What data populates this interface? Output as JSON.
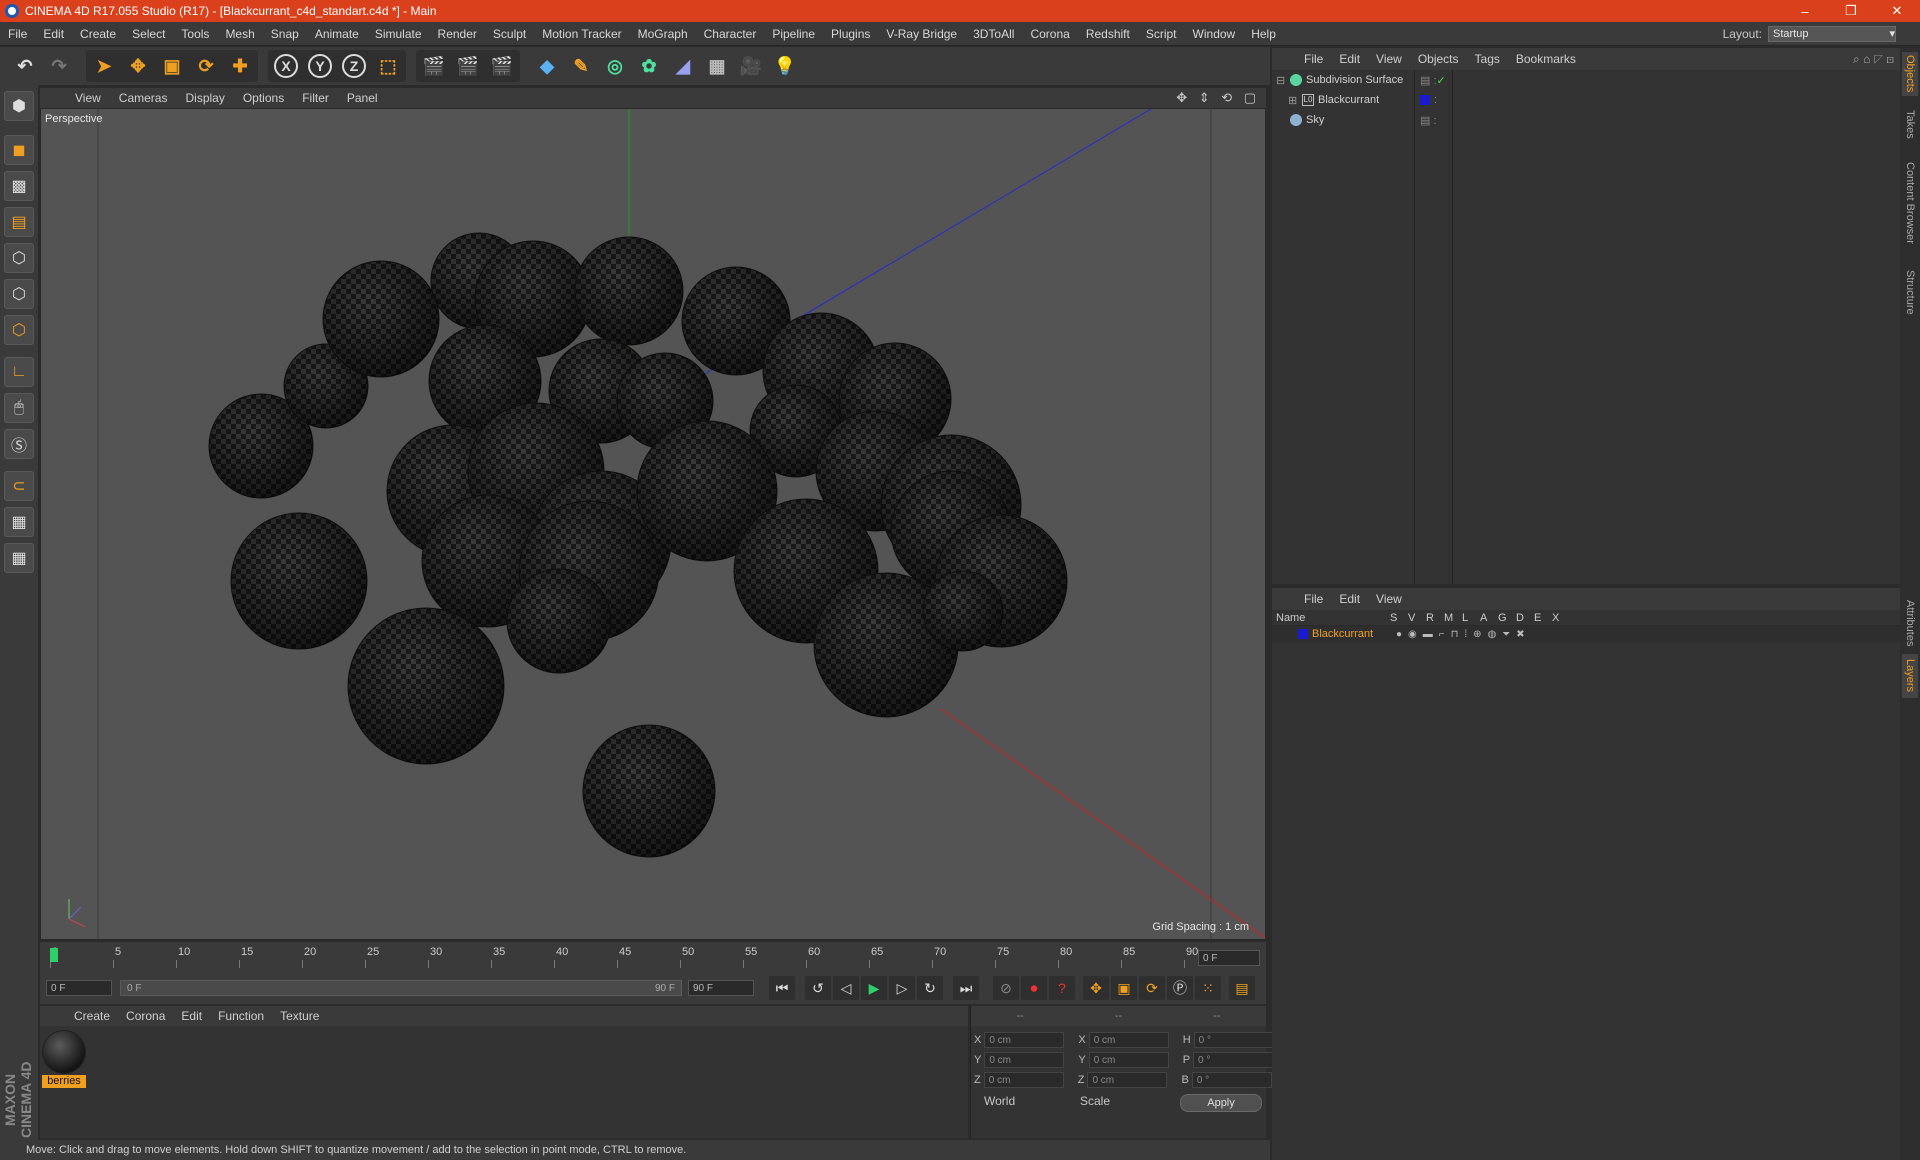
{
  "window": {
    "title": "CINEMA 4D R17.055 Studio (R17) - [Blackcurrant_c4d_standart.c4d *] - Main",
    "controls": [
      "–",
      "❐",
      "✕"
    ]
  },
  "menubar": {
    "items": [
      "File",
      "Edit",
      "Create",
      "Select",
      "Tools",
      "Mesh",
      "Snap",
      "Animate",
      "Simulate",
      "Render",
      "Sculpt",
      "Motion Tracker",
      "MoGraph",
      "Character",
      "Pipeline",
      "Plugins",
      "V-Ray Bridge",
      "3DToAll",
      "Corona",
      "Redshift",
      "Script",
      "Window",
      "Help"
    ],
    "layout_label": "Layout:",
    "layout_value": "Startup"
  },
  "toolbar": {
    "axis_x": "X",
    "axis_y": "Y",
    "axis_z": "Z"
  },
  "viewport": {
    "menu": [
      "View",
      "Cameras",
      "Display",
      "Options",
      "Filter",
      "Panel"
    ],
    "label": "Perspective",
    "grid_spacing": "Grid Spacing : 1 cm",
    "nav_icons": "✥ ⇕ ⟲ ▢"
  },
  "timeline": {
    "ticks": [
      "0",
      "5",
      "10",
      "15",
      "20",
      "25",
      "30",
      "35",
      "40",
      "45",
      "50",
      "55",
      "60",
      "65",
      "70",
      "75",
      "80",
      "85",
      "90"
    ],
    "current_frame": "0 F"
  },
  "transport": {
    "start_field": "0 F",
    "range_start": "0 F",
    "range_end": "90 F",
    "end_field": "90 F"
  },
  "material_panel": {
    "menu": [
      "Create",
      "Corona",
      "Edit",
      "Function",
      "Texture"
    ],
    "material_name": "berries"
  },
  "coords": {
    "header": [
      "--",
      "--",
      "--"
    ],
    "rows": [
      {
        "a_label": "X",
        "a_val": "0 cm",
        "b_label": "X",
        "b_val": "0 cm",
        "c_label": "H",
        "c_val": "0 °"
      },
      {
        "a_label": "Y",
        "a_val": "0 cm",
        "b_label": "Y",
        "b_val": "0 cm",
        "c_label": "P",
        "c_val": "0 °"
      },
      {
        "a_label": "Z",
        "a_val": "0 cm",
        "b_label": "Z",
        "b_val": "0 cm",
        "c_label": "B",
        "c_val": "0 °"
      }
    ],
    "space_dropdown": "World",
    "mode_dropdown": "Scale",
    "apply_label": "Apply"
  },
  "status": {
    "text": "Move: Click and drag to move elements. Hold down SHIFT to quantize movement / add to the selection in point mode, CTRL to remove."
  },
  "branding": {
    "logo_text": "MAXON CINEMA 4D"
  },
  "object_manager": {
    "menu": [
      "File",
      "Edit",
      "View",
      "Objects",
      "Tags",
      "Bookmarks"
    ],
    "objects": [
      {
        "name": "Subdivision Surface",
        "color": "#5ad5a0"
      },
      {
        "name": "Blackcurrant",
        "color": "#1a1ad0"
      },
      {
        "name": "Sky",
        "color": "#8fb0d0"
      }
    ]
  },
  "layer_manager": {
    "menu": [
      "File",
      "Edit",
      "View"
    ],
    "columns": [
      "Name",
      "S",
      "V",
      "R",
      "M",
      "L",
      "A",
      "G",
      "D",
      "E",
      "X"
    ],
    "layer_name": "Blackcurrant",
    "layer_color": "#1a1ad0"
  },
  "side_tabs": [
    "Objects",
    "Takes",
    "Content Browser",
    "Structure",
    "Attributes",
    "Layers"
  ],
  "colors": {
    "title_bg": "#d9401b",
    "accent_orange": "#f0a020",
    "ui_dark": "#333333"
  }
}
